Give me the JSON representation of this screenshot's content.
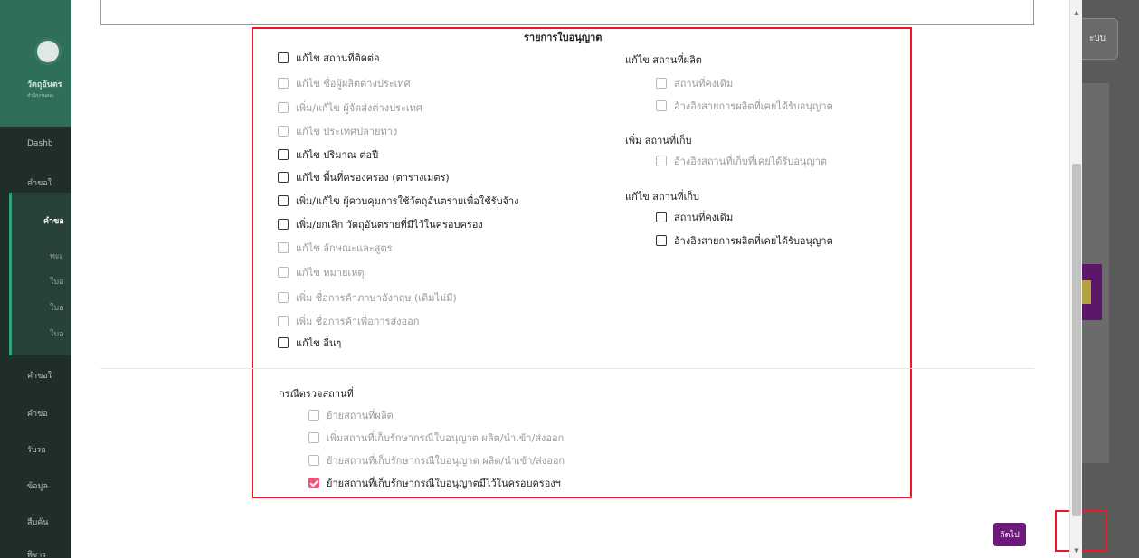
{
  "background": {
    "brand": "วัตถุอันตร",
    "brand_sub": "สำนักงานคณ",
    "menu": [
      "Dashb",
      "คำขอใ",
      "คำขอ",
      "คำขอใ",
      "คำขอ",
      "รับรอ",
      "ข้อมูล",
      "สืบค้น",
      "พิจาร"
    ],
    "submenu": [
      "ทะเ",
      "ใบอ",
      "ใบอ",
      "ใบอ"
    ],
    "right_top_label": "ะบบ"
  },
  "modal": {
    "section_title": "รายการใบอนุญาต",
    "left_items": [
      {
        "label": "แก้ไข สถานที่ติดต่อ",
        "enabled": true,
        "checked": false
      },
      {
        "label": "แก้ไข ชื่อผู้ผลิตต่างประเทศ",
        "enabled": false,
        "checked": false
      },
      {
        "label": "เพิ่ม/แก้ไข ผู้จัดส่งต่างประเทศ",
        "enabled": false,
        "checked": false
      },
      {
        "label": "แก้ไข ประเทศปลายทาง",
        "enabled": false,
        "checked": false
      },
      {
        "label": "แก้ไข ปริมาณ ต่อปี",
        "enabled": true,
        "checked": false
      },
      {
        "label": "แก้ไข พื้นที่ครองครอง (ตารางเมตร)",
        "enabled": true,
        "checked": false
      },
      {
        "label": "เพิ่ม/แก้ไข ผู้ควบคุมการใช้วัตถุอันตรายเพื่อใช้รับจ้าง",
        "enabled": true,
        "checked": false
      },
      {
        "label": "เพิ่ม/ยกเลิก วัตถุอันตรายที่มีไว้ในครอบครอง",
        "enabled": true,
        "checked": false
      },
      {
        "label": "แก้ไข ลักษณะและสูตร",
        "enabled": false,
        "checked": false
      },
      {
        "label": "แก้ไข หมายเหตุ",
        "enabled": false,
        "checked": false
      },
      {
        "label": "เพิ่ม ชื่อการค้าภาษาอังกฤษ (เดิมไม่มี)",
        "enabled": false,
        "checked": false
      },
      {
        "label": "เพิ่ม ชื่อการค้าเพื่อการส่งออก",
        "enabled": false,
        "checked": false
      },
      {
        "label": "แก้ไข อื่นๆ",
        "enabled": true,
        "checked": false
      }
    ],
    "right_groups": [
      {
        "label": "แก้ไข สถานที่ผลิต",
        "items": [
          {
            "label": "สถานที่คงเดิม",
            "enabled": false,
            "checked": false
          },
          {
            "label": "อ้างอิงสายการผลิตที่เคยได้รับอนุญาต",
            "enabled": false,
            "checked": false
          }
        ]
      },
      {
        "label": "เพิ่ม สถานที่เก็บ",
        "items": [
          {
            "label": "อ้างอิงสถานที่เก็บที่เคยได้รับอนุญาต",
            "enabled": false,
            "checked": false
          }
        ]
      },
      {
        "label": "แก้ไข สถานที่เก็บ",
        "items": [
          {
            "label": "สถานที่คงเดิม",
            "enabled": true,
            "checked": false
          },
          {
            "label": "อ้างอิงสายการผลิตที่เคยได้รับอนุญาต",
            "enabled": true,
            "checked": false
          }
        ]
      }
    ],
    "inspection": {
      "label": "กรณีตรวจสถานที่",
      "items": [
        {
          "label": "ย้ายสถานที่ผลิต",
          "enabled": false,
          "checked": false
        },
        {
          "label": "เพิ่มสถานที่เก็บรักษากรณีใบอนุญาต ผลิต/นำเข้า/ส่งออก",
          "enabled": false,
          "checked": false
        },
        {
          "label": "ย้ายสถานที่เก็บรักษากรณีใบอนุญาต ผลิต/นำเข้า/ส่งออก",
          "enabled": false,
          "checked": false
        },
        {
          "label": "ย้ายสถานที่เก็บรักษากรณีใบอนุญาตมีไว้ในครอบครองฯ",
          "enabled": true,
          "checked": true
        }
      ]
    },
    "next_button": "ถัดไป"
  },
  "colors": {
    "accent_purple": "#6b1a7a",
    "highlight_red": "#e8182a",
    "checkbox_checked": "#f0527b"
  }
}
